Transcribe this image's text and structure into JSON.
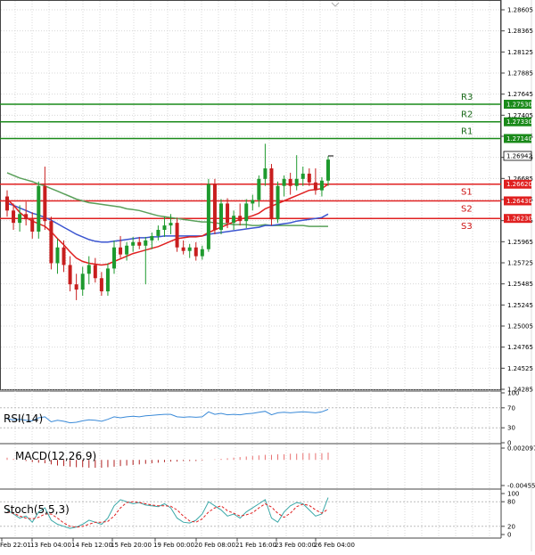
{
  "chart_data": {
    "type": "candlestick",
    "price_axis": {
      "ticks": [
        "1.28605",
        "1.28365",
        "1.28125",
        "1.27885",
        "1.27645",
        "1.27405",
        "1.27165",
        "1.26925",
        "1.26685",
        "1.26445",
        "1.26205",
        "1.25965",
        "1.25725",
        "1.25485",
        "1.25245",
        "1.25005",
        "1.24765",
        "1.24525",
        "1.24285"
      ],
      "ylim": [
        1.24285,
        1.28605
      ]
    },
    "levels": [
      {
        "label": "R3",
        "value": "1.27530",
        "color": "#1a8a1a"
      },
      {
        "label": "R2",
        "value": "1.27330",
        "color": "#1a8a1a"
      },
      {
        "label": "R1",
        "value": "1.27140",
        "color": "#1a8a1a"
      },
      {
        "label": "S1",
        "value": "1.26620",
        "color": "#e02020"
      },
      {
        "label": "S2",
        "value": "1.26430",
        "color": "#e02020"
      },
      {
        "label": "S3",
        "value": "1.26230",
        "color": "#e02020"
      }
    ],
    "current_price": "1.26942",
    "x_labels": [
      "Feb 22:01",
      "13 Feb 04:00",
      "14 Feb 12:00",
      "15 Feb 20:00",
      "19 Feb 00:00",
      "20 Feb 08:00",
      "21 Feb 16:00",
      "23 Feb 00:00",
      "26 Feb 04:00"
    ],
    "candles": [
      [
        1.2648,
        1.2655,
        1.2625,
        1.2632
      ],
      [
        1.2632,
        1.264,
        1.261,
        1.2618
      ],
      [
        1.2618,
        1.2638,
        1.2608,
        1.2628
      ],
      [
        1.2628,
        1.2642,
        1.2615,
        1.2622
      ],
      [
        1.2622,
        1.263,
        1.26,
        1.2608
      ],
      [
        1.2608,
        1.2665,
        1.26,
        1.266
      ],
      [
        1.266,
        1.2682,
        1.261,
        1.262
      ],
      [
        1.262,
        1.2625,
        1.2565,
        1.2572
      ],
      [
        1.2572,
        1.26,
        1.256,
        1.259
      ],
      [
        1.259,
        1.2598,
        1.2562,
        1.257
      ],
      [
        1.257,
        1.258,
        1.254,
        1.2548
      ],
      [
        1.2548,
        1.256,
        1.253,
        1.2542
      ],
      [
        1.2542,
        1.2568,
        1.2535,
        1.256
      ],
      [
        1.256,
        1.258,
        1.2548,
        1.257
      ],
      [
        1.257,
        1.2578,
        1.255,
        1.2555
      ],
      [
        1.2555,
        1.2562,
        1.2535,
        1.254
      ],
      [
        1.254,
        1.2572,
        1.2535,
        1.2566
      ],
      [
        1.2566,
        1.2598,
        1.256,
        1.259
      ],
      [
        1.259,
        1.2603,
        1.2578,
        1.2582
      ],
      [
        1.2582,
        1.2596,
        1.2575,
        1.2592
      ],
      [
        1.2592,
        1.2602,
        1.2585,
        1.2596
      ],
      [
        1.2596,
        1.2602,
        1.2588,
        1.2592
      ],
      [
        1.2592,
        1.2602,
        1.2548,
        1.2598
      ],
      [
        1.2598,
        1.2607,
        1.2588,
        1.2603
      ],
      [
        1.2603,
        1.2615,
        1.2598,
        1.261
      ],
      [
        1.261,
        1.2625,
        1.2602,
        1.2615
      ],
      [
        1.2615,
        1.2628,
        1.2605,
        1.2618
      ],
      [
        1.2618,
        1.2624,
        1.2585,
        1.259
      ],
      [
        1.259,
        1.2598,
        1.2582,
        1.2586
      ],
      [
        1.2586,
        1.2594,
        1.2578,
        1.259
      ],
      [
        1.259,
        1.2596,
        1.2575,
        1.258
      ],
      [
        1.258,
        1.2592,
        1.2576,
        1.2588
      ],
      [
        1.2588,
        1.2668,
        1.2585,
        1.2662
      ],
      [
        1.2662,
        1.2668,
        1.2605,
        1.261
      ],
      [
        1.261,
        1.2645,
        1.2605,
        1.264
      ],
      [
        1.264,
        1.2646,
        1.2612,
        1.2618
      ],
      [
        1.2618,
        1.2632,
        1.261,
        1.2626
      ],
      [
        1.2626,
        1.264,
        1.2615,
        1.262
      ],
      [
        1.262,
        1.2645,
        1.2612,
        1.264
      ],
      [
        1.264,
        1.265,
        1.2632,
        1.2644
      ],
      [
        1.2644,
        1.2672,
        1.2636,
        1.2668
      ],
      [
        1.2668,
        1.2708,
        1.266,
        1.268
      ],
      [
        1.268,
        1.2685,
        1.2615,
        1.2622
      ],
      [
        1.2622,
        1.2665,
        1.2618,
        1.266
      ],
      [
        1.266,
        1.2672,
        1.2648,
        1.2668
      ],
      [
        1.2668,
        1.2675,
        1.265,
        1.266
      ],
      [
        1.266,
        1.2695,
        1.2655,
        1.2668
      ],
      [
        1.2668,
        1.2682,
        1.266,
        1.2674
      ],
      [
        1.2674,
        1.268,
        1.266,
        1.2664
      ],
      [
        1.2664,
        1.268,
        1.265,
        1.2655
      ],
      [
        1.2655,
        1.267,
        1.2648,
        1.2666
      ],
      [
        1.2666,
        1.2694,
        1.266,
        1.269
      ]
    ],
    "ma_red": [
      1.2645,
      1.2638,
      1.263,
      1.2624,
      1.262,
      1.2617,
      1.2614,
      1.2608,
      1.26,
      1.2593,
      1.2585,
      1.2578,
      1.2574,
      1.2572,
      1.2571,
      1.257,
      1.2571,
      1.2574,
      1.2577,
      1.258,
      1.2583,
      1.2585,
      1.2587,
      1.2589,
      1.2591,
      1.2594,
      1.2597,
      1.26,
      1.2601,
      1.2602,
      1.2602,
      1.2603,
      1.2607,
      1.261,
      1.2613,
      1.2616,
      1.2619,
      1.2622,
      1.2624,
      1.2626,
      1.2629,
      1.2634,
      1.2637,
      1.264,
      1.2643,
      1.2646,
      1.2649,
      1.2652,
      1.2655,
      1.2656,
      1.2657,
      1.2662
    ],
    "ma_blue": [
      1.264,
      1.2638,
      1.2635,
      1.2632,
      1.2629,
      1.2627,
      1.2624,
      1.2621,
      1.2617,
      1.2613,
      1.2609,
      1.2605,
      1.2602,
      1.2599,
      1.2597,
      1.2596,
      1.2596,
      1.2597,
      1.2598,
      1.2599,
      1.26,
      1.2601,
      1.2601,
      1.2602,
      1.2602,
      1.2603,
      1.2603,
      1.2603,
      1.2603,
      1.2603,
      1.2603,
      1.2603,
      1.2605,
      1.2606,
      1.2607,
      1.2608,
      1.2609,
      1.261,
      1.2611,
      1.2612,
      1.2613,
      1.2615,
      1.2615,
      1.2616,
      1.2617,
      1.2618,
      1.262,
      1.2621,
      1.2622,
      1.2623,
      1.2624,
      1.2628
    ],
    "ma_green": [
      1.2675,
      1.2672,
      1.2669,
      1.2667,
      1.2665,
      1.2662,
      1.266,
      1.2657,
      1.2654,
      1.2651,
      1.2648,
      1.2645,
      1.2643,
      1.2641,
      1.264,
      1.2639,
      1.2638,
      1.2637,
      1.2636,
      1.2634,
      1.2633,
      1.2632,
      1.263,
      1.2628,
      1.2626,
      1.2625,
      1.2624,
      1.2623,
      1.2622,
      1.2621,
      1.262,
      1.2619,
      1.2619,
      1.2618,
      1.2617,
      1.2617,
      1.2616,
      1.2616,
      1.2616,
      1.2615,
      1.2615,
      1.2616,
      1.2615,
      1.2615,
      1.2615,
      1.2615,
      1.2615,
      1.2615,
      1.2614,
      1.2614,
      1.2614,
      1.2614
    ],
    "indicators": [
      {
        "name": "RSI(14)",
        "ticks": [
          "100",
          "70",
          "30",
          "0"
        ],
        "range": [
          0,
          100
        ],
        "values": [
          48,
          46,
          47,
          45,
          44,
          50,
          52,
          42,
          45,
          43,
          40,
          41,
          44,
          46,
          45,
          43,
          47,
          52,
          50,
          52,
          53,
          52,
          54,
          55,
          56,
          57,
          57,
          52,
          51,
          52,
          51,
          52,
          62,
          57,
          59,
          56,
          57,
          56,
          58,
          59,
          61,
          63,
          56,
          60,
          61,
          60,
          61,
          62,
          61,
          60,
          62,
          67
        ]
      },
      {
        "name": "MACD(12,26,9)",
        "ticks": [
          "0.002097",
          "-0.004555"
        ],
        "range": [
          -0.004555,
          0.002097
        ],
        "values": [
          0.0004,
          0.0002,
          0.0,
          -0.0002,
          -0.0004,
          -0.0005,
          -0.0006,
          -0.0008,
          -0.001,
          -0.0011,
          -0.0012,
          -0.0013,
          -0.0013,
          -0.0014,
          -0.0014,
          -0.0014,
          -0.0013,
          -0.0012,
          -0.0011,
          -0.001,
          -0.0009,
          -0.0008,
          -0.0007,
          -0.0006,
          -0.0005,
          -0.0004,
          -0.0003,
          -0.0003,
          -0.0002,
          -0.0002,
          -0.0002,
          -0.0001,
          0.0,
          0.0001,
          0.0002,
          0.0003,
          0.0004,
          0.0005,
          0.0006,
          0.0007,
          0.0008,
          0.0009,
          0.0009,
          0.001,
          0.001,
          0.0011,
          0.0011,
          0.0012,
          0.0012,
          0.0012,
          0.0012,
          0.0013
        ]
      },
      {
        "name": "Stoch(5,5,3)",
        "ticks": [
          "100",
          "80",
          "20",
          "0"
        ],
        "range": [
          0,
          100
        ],
        "k": [
          60,
          50,
          40,
          45,
          30,
          55,
          65,
          35,
          25,
          20,
          15,
          18,
          25,
          35,
          30,
          25,
          40,
          70,
          85,
          80,
          75,
          78,
          72,
          70,
          68,
          75,
          65,
          40,
          30,
          28,
          35,
          50,
          80,
          70,
          60,
          45,
          50,
          40,
          55,
          65,
          75,
          85,
          40,
          30,
          55,
          70,
          78,
          75,
          60,
          45,
          50,
          90
        ],
        "d": [
          55,
          52,
          45,
          40,
          38,
          42,
          50,
          50,
          40,
          28,
          20,
          18,
          20,
          25,
          30,
          30,
          32,
          45,
          65,
          78,
          80,
          78,
          75,
          72,
          70,
          70,
          69,
          60,
          45,
          33,
          30,
          38,
          55,
          65,
          70,
          58,
          52,
          45,
          48,
          53,
          65,
          75,
          67,
          52,
          42,
          52,
          68,
          74,
          71,
          60,
          52,
          62
        ]
      }
    ]
  }
}
